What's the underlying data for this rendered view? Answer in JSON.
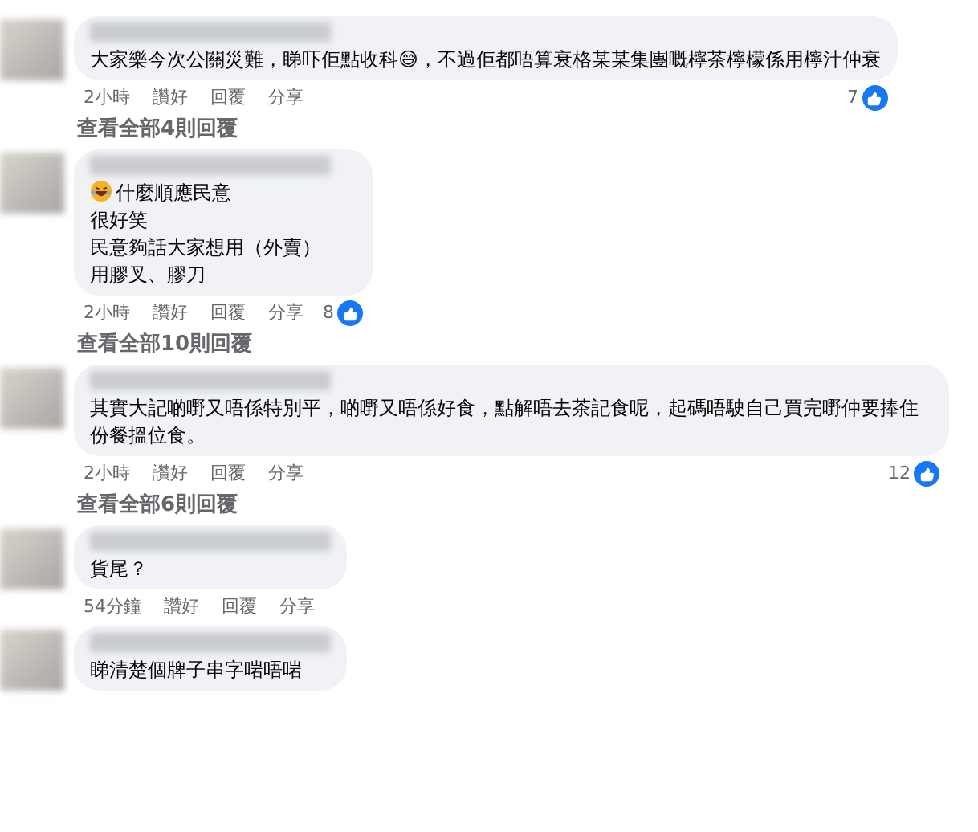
{
  "comments": [
    {
      "lines": [
        "大家樂今次公關災難，睇吓佢點收科😅，不過佢都唔算衰格某某集團嘅檸茶檸檬係用檸汁仲衰"
      ],
      "time": "2小時",
      "actions": [
        "讚好",
        "回覆",
        "分享"
      ],
      "likes": "7",
      "replies": "查看全部4則回覆"
    },
    {
      "lines": [
        "什麼順應民意",
        "很好笑",
        "民意夠話大家想用（外賣）",
        "用膠叉、膠刀"
      ],
      "lead_emoji": true,
      "time": "2小時",
      "actions": [
        "讚好",
        "回覆",
        "分享"
      ],
      "likes": "8",
      "replies": "查看全部10則回覆"
    },
    {
      "lines": [
        "其實大記啲嘢又唔係特別平，啲嘢又唔係好食，點解唔去茶記食呢，起碼唔駛自己買完嘢仲要捧住份餐搵位食。"
      ],
      "time": "2小時",
      "actions": [
        "讚好",
        "回覆",
        "分享"
      ],
      "likes": "12",
      "replies": "查看全部6則回覆"
    },
    {
      "lines": [
        "貨尾？"
      ],
      "time": "54分鐘",
      "actions": [
        "讚好",
        "回覆",
        "分享"
      ]
    },
    {
      "lines": [
        "睇清楚個牌子串字啱唔啱"
      ]
    }
  ]
}
